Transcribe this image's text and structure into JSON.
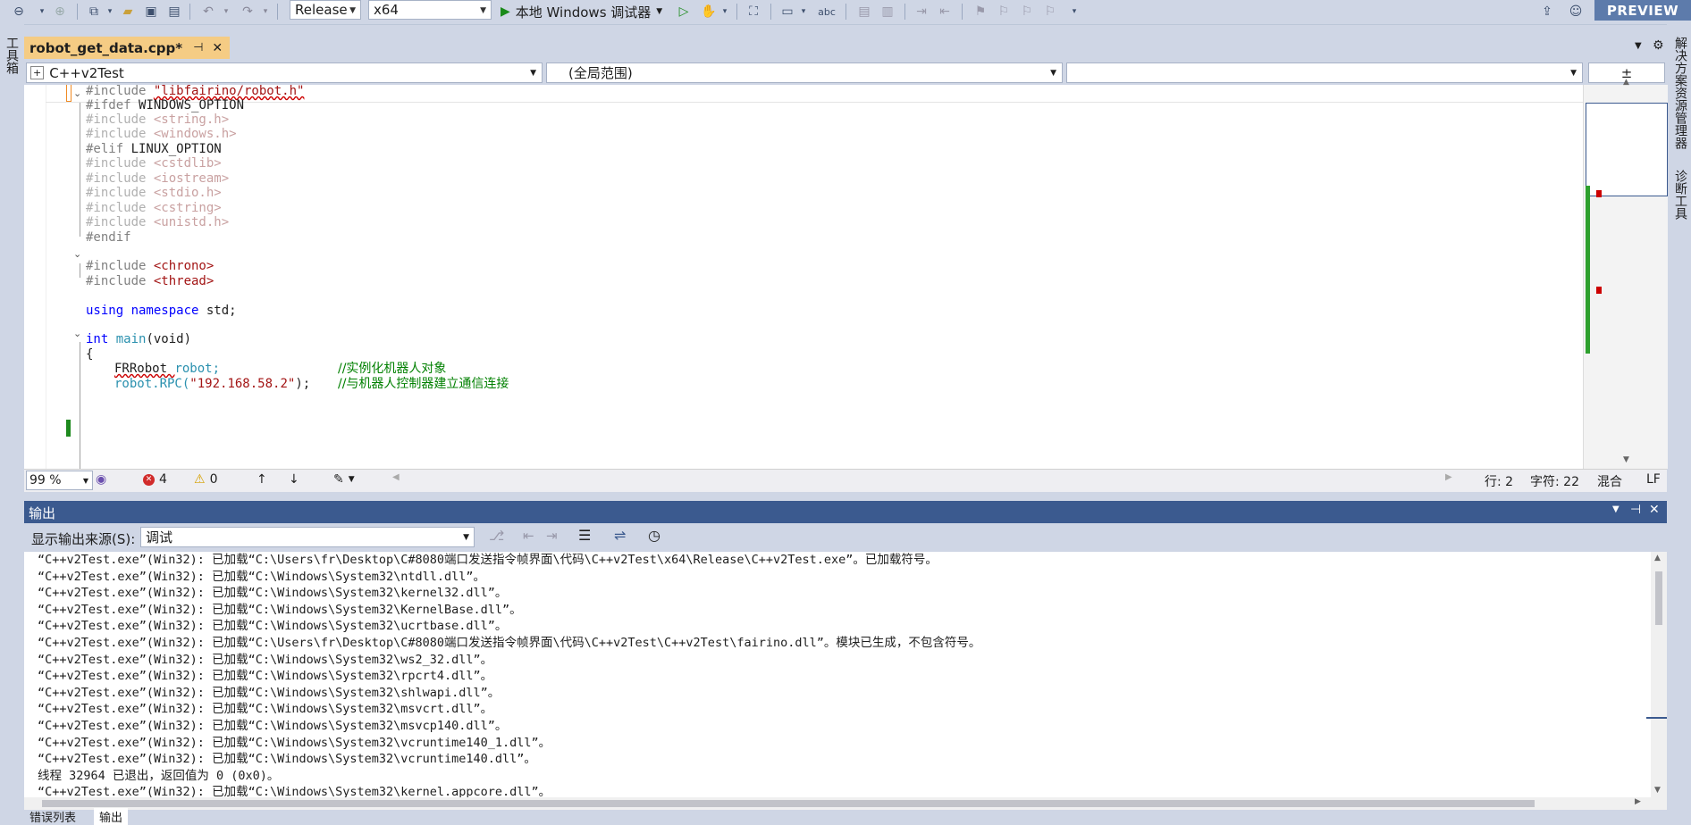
{
  "toolbar": {
    "config_value": "Release",
    "platform_value": "x64",
    "debugger_label": "本地 Windows 调试器",
    "preview_label": "PREVIEW"
  },
  "left_strip": {
    "label": "工具箱"
  },
  "right_strip": {
    "label1": "解决方案资源管理器",
    "label2": "诊断工具"
  },
  "tab": {
    "filename": "robot_get_data.cpp*"
  },
  "nav": {
    "project": "C++v2Test",
    "scope": "(全局范围)",
    "member": ""
  },
  "code": [
    {
      "t1": "#include ",
      "t2": "\"libfairino/robot.h\""
    },
    {
      "t1": "#ifdef ",
      "t2": "WINDOWS_OPTION"
    },
    {
      "t1": "#include ",
      "t2": "<string.h>"
    },
    {
      "t1": "#include ",
      "t2": "<windows.h>"
    },
    {
      "t1": "#elif ",
      "t2": "LINUX_OPTION"
    },
    {
      "t1": "#include ",
      "t2": "<cstdlib>"
    },
    {
      "t1": "#include ",
      "t2": "<iostream>"
    },
    {
      "t1": "#include ",
      "t2": "<stdio.h>"
    },
    {
      "t1": "#include ",
      "t2": "<cstring>"
    },
    {
      "t1": "#include ",
      "t2": "<unistd.h>"
    },
    {
      "t1": "#endif",
      "t2": ""
    },
    {
      "t1": "#include ",
      "t2": "<chrono>"
    },
    {
      "t1": "#include ",
      "t2": "<thread>"
    },
    {
      "t1": "using ",
      "t2": "namespace ",
      "t3": "std;"
    },
    {
      "t1": "int ",
      "t2": "main",
      "t3": "(void)"
    },
    {
      "t1": "{",
      "t2": ""
    },
    {
      "t1": "FRRobot ",
      "t2": "robot;",
      "t3": "//实例化机器人对象"
    },
    {
      "t1": "robot.",
      "t2": "RPC(",
      "t3": "\"192.168.58.2\"",
      "t4": ");",
      "t5": "//与机器人控制器建立通信连接"
    }
  ],
  "status": {
    "zoom": "99 %",
    "errors": "4",
    "warnings": "0",
    "line": "行: 2",
    "char": "字符: 22",
    "mixed": "混合",
    "eol": "LF"
  },
  "output": {
    "title": "输出",
    "source_label": "显示输出来源(S):",
    "source_value": "调试",
    "lines": [
      "“C++v2Test.exe”(Win32): 已加载“C:\\Users\\fr\\Desktop\\C#8080端口发送指令帧界面\\代码\\C++v2Test\\x64\\Release\\C++v2Test.exe”。已加载符号。",
      "“C++v2Test.exe”(Win32): 已加载“C:\\Windows\\System32\\ntdll.dll”。",
      "“C++v2Test.exe”(Win32): 已加载“C:\\Windows\\System32\\kernel32.dll”。",
      "“C++v2Test.exe”(Win32): 已加载“C:\\Windows\\System32\\KernelBase.dll”。",
      "“C++v2Test.exe”(Win32): 已加载“C:\\Windows\\System32\\ucrtbase.dll”。",
      "“C++v2Test.exe”(Win32): 已加载“C:\\Users\\fr\\Desktop\\C#8080端口发送指令帧界面\\代码\\C++v2Test\\C++v2Test\\fairino.dll”。模块已生成，不包含符号。",
      "“C++v2Test.exe”(Win32): 已加载“C:\\Windows\\System32\\ws2_32.dll”。",
      "“C++v2Test.exe”(Win32): 已加载“C:\\Windows\\System32\\rpcrt4.dll”。",
      "“C++v2Test.exe”(Win32): 已加载“C:\\Windows\\System32\\shlwapi.dll”。",
      "“C++v2Test.exe”(Win32): 已加载“C:\\Windows\\System32\\msvcrt.dll”。",
      "“C++v2Test.exe”(Win32): 已加载“C:\\Windows\\System32\\msvcp140.dll”。",
      "“C++v2Test.exe”(Win32): 已加载“C:\\Windows\\System32\\vcruntime140_1.dll”。",
      "“C++v2Test.exe”(Win32): 已加载“C:\\Windows\\System32\\vcruntime140.dll”。",
      "线程 32964 已退出，返回值为 0 (0x0)。",
      "“C++v2Test.exe”(Win32): 已加载“C:\\Windows\\System32\\kernel.appcore.dll”。"
    ]
  },
  "bottom_tabs": {
    "errors_tab": "错误列表",
    "output_tab": "输出"
  }
}
